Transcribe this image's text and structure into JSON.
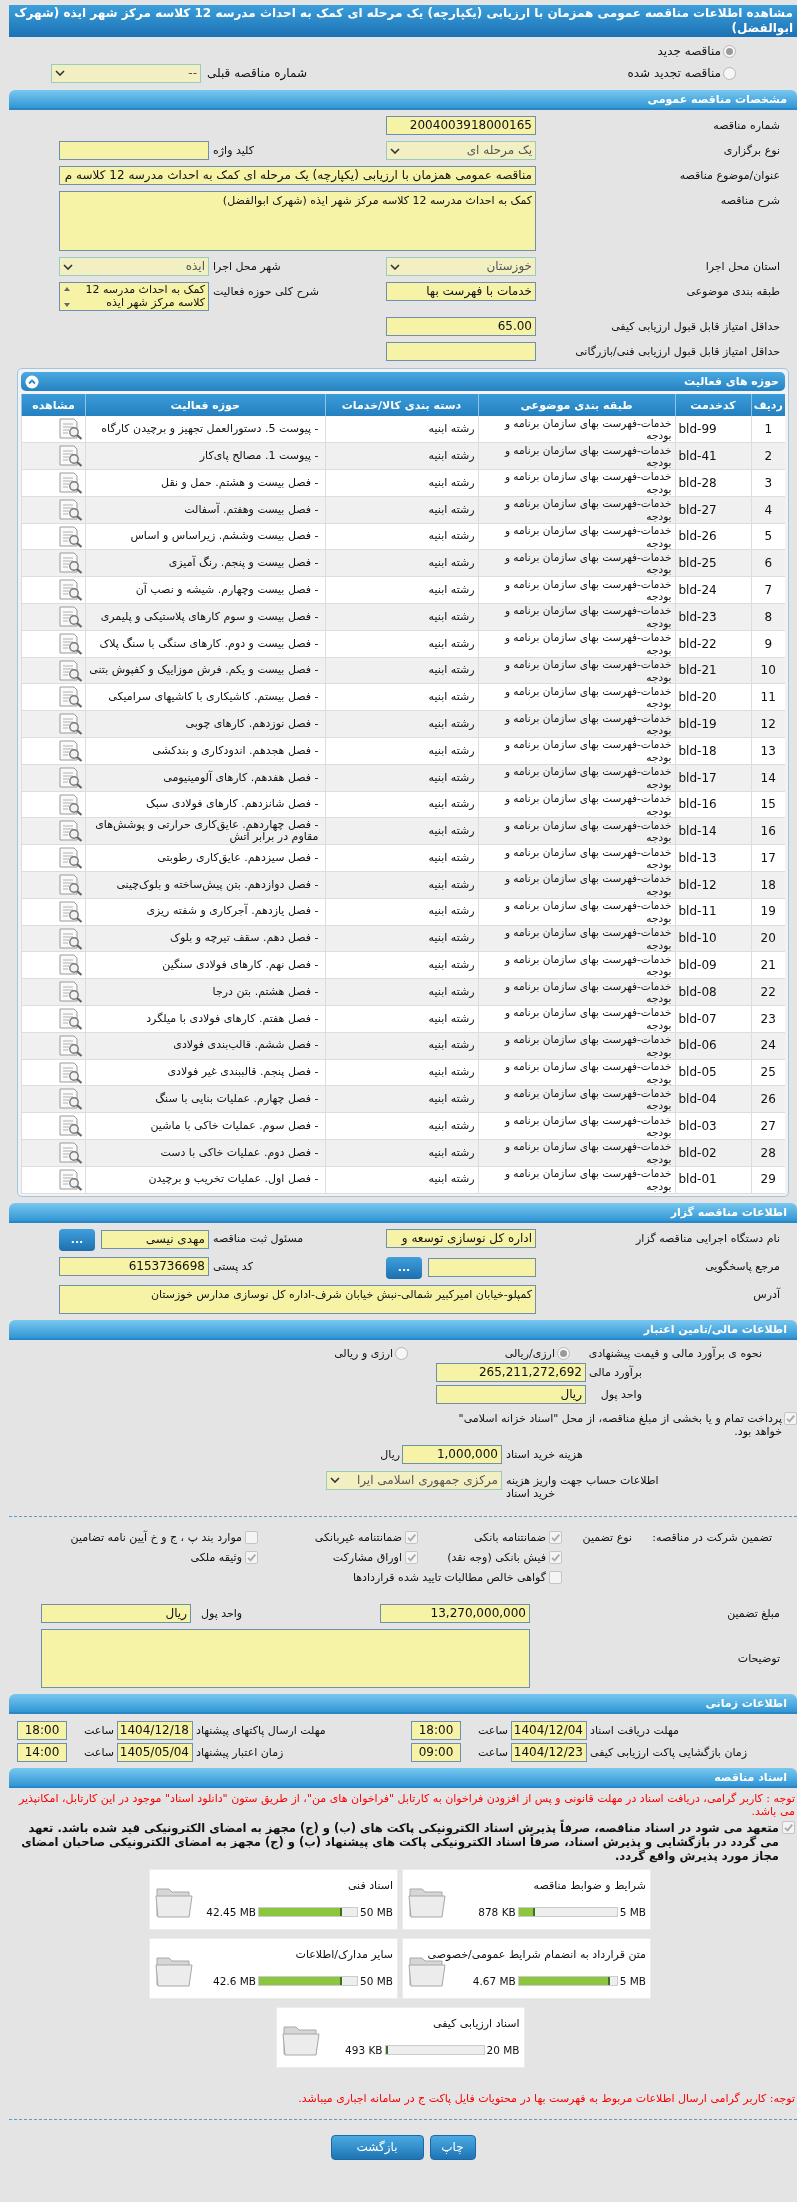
{
  "title": "مشاهده اطلاعات مناقصه عمومی همزمان با ارزیابی (یکپارچه) یک مرحله ای کمک به احداث مدرسه 12 کلاسه مرکز شهر ایذه (شهرک ابوالفضل)",
  "tender_status": [
    {
      "label": "مناقصه جدید",
      "selected": true
    },
    {
      "label": "مناقصه تجدید شده",
      "selected": false
    }
  ],
  "previous_tender": {
    "label": "شماره مناقصه قبلی",
    "kind": "select",
    "value": "--"
  },
  "general": {
    "header": "مشخصات مناقصه عمومی",
    "rows": [
      [
        {
          "label": "شماره مناقصه",
          "kind": "text",
          "value": "2004003918000165"
        }
      ],
      [
        {
          "label": "نوع برگزاری",
          "kind": "select",
          "value": "یک مرحله ای"
        },
        {
          "label": "کلید واژه",
          "kind": "text"
        }
      ],
      [
        {
          "label": "عنوان/موضوع مناقصه",
          "kind": "wide",
          "value": "مناقصه عمومی همزمان با ارزیابی (یکپارچه) یک مرحله ای کمک به احداث مدرسه 12 کلاسه م"
        }
      ],
      [
        {
          "label": "شرح مناقصه",
          "kind": "textarea",
          "value": "کمک به احداث مدرسه 12 کلاسه مرکز شهر ایذه (شهرک ابوالفضل)"
        }
      ],
      [
        {
          "label": "استان محل اجرا",
          "kind": "select",
          "value": "خوزستان"
        },
        {
          "label": "شهر محل اجرا",
          "kind": "select",
          "value": "ایذه"
        }
      ],
      [
        {
          "label": "طبقه بندی موضوعی",
          "kind": "text",
          "value": "خدمات با فهرست بها"
        },
        {
          "label": "شرح کلی حوزه فعالیت",
          "kind": "listbox",
          "value": "کمک به احداث مدرسه 12 کلاسه مرکز شهر ایذه"
        }
      ],
      [
        {
          "label": "حداقل امتیاز قابل قبول ارزیابی کیفی",
          "kind": "text",
          "value": "65.00"
        }
      ],
      [
        {
          "label": "حداقل امتیاز قابل قبول ارزیابی فنی/بازرگانی",
          "kind": "text"
        }
      ]
    ]
  },
  "activities": {
    "header": "حوزه های فعالیت",
    "columns": [
      "ردیف",
      "کدخدمت",
      "طبقه بندی موضوعی",
      "دسته بندی کالا/خدمات",
      "حوزه فعالیت",
      "مشاهده"
    ],
    "rows": [
      {
        "row": "1",
        "code": "bld-99",
        "category": "خدمات-فهرست بهای سازمان برنامه و بودجه",
        "group": "رشته ابنیه",
        "activity": "- پیوست 5. دستورالعمل تجهیز و برچیدن کارگاه"
      },
      {
        "row": "2",
        "code": "bld-41",
        "category": "خدمات-فهرست بهای سازمان برنامه و بودجه",
        "group": "رشته ابنیه",
        "activity": "- پیوست 1. مصالح پای‌کار"
      },
      {
        "row": "3",
        "code": "bld-28",
        "category": "خدمات-فهرست بهای سازمان برنامه و بودجه",
        "group": "رشته ابنیه",
        "activity": "- فصل بیست و هشتم. حمل و نقل"
      },
      {
        "row": "4",
        "code": "bld-27",
        "category": "خدمات-فهرست بهای سازمان برنامه و بودجه",
        "group": "رشته ابنیه",
        "activity": "- فصل بیست وهفتم. آسفالت"
      },
      {
        "row": "5",
        "code": "bld-26",
        "category": "خدمات-فهرست بهای سازمان برنامه و بودجه",
        "group": "رشته ابنیه",
        "activity": "- فصل بیست وششم. زیراساس و اساس"
      },
      {
        "row": "6",
        "code": "bld-25",
        "category": "خدمات-فهرست بهای سازمان برنامه و بودجه",
        "group": "رشته ابنیه",
        "activity": "- فصل بیست و پنجم. رنگ آمیزی"
      },
      {
        "row": "7",
        "code": "bld-24",
        "category": "خدمات-فهرست بهای سازمان برنامه و بودجه",
        "group": "رشته ابنیه",
        "activity": "- فصل بیست وچهارم. شیشه و نصب آن"
      },
      {
        "row": "8",
        "code": "bld-23",
        "category": "خدمات-فهرست بهای سازمان برنامه و بودجه",
        "group": "رشته ابنیه",
        "activity": "- فصل بیست و سوم کارهای پلاستیکی و پلیمری"
      },
      {
        "row": "9",
        "code": "bld-22",
        "category": "خدمات-فهرست بهای سازمان برنامه و بودجه",
        "group": "رشته ابنیه",
        "activity": "- فصل بیست و دوم. کارهای سنگی با سنگ پلاک"
      },
      {
        "row": "10",
        "code": "bld-21",
        "category": "خدمات-فهرست بهای سازمان برنامه و بودجه",
        "group": "رشته ابنیه",
        "activity": "- فصل بیست و یکم. فرش موزاییک و کفپوش بتنی"
      },
      {
        "row": "11",
        "code": "bld-20",
        "category": "خدمات-فهرست بهای سازمان برنامه و بودجه",
        "group": "رشته ابنیه",
        "activity": "- فصل بیستم. کاشیکاری با کاشیهای سرامیکی"
      },
      {
        "row": "12",
        "code": "bld-19",
        "category": "خدمات-فهرست بهای سازمان برنامه و بودجه",
        "group": "رشته ابنیه",
        "activity": "- فصل نوزدهم. کارهای چوبی"
      },
      {
        "row": "13",
        "code": "bld-18",
        "category": "خدمات-فهرست بهای سازمان برنامه و بودجه",
        "group": "رشته ابنیه",
        "activity": "- فصل هجدهم. اندودکاری و بندکشی"
      },
      {
        "row": "14",
        "code": "bld-17",
        "category": "خدمات-فهرست بهای سازمان برنامه و بودجه",
        "group": "رشته ابنیه",
        "activity": "- فصل هفدهم. کارهای آلومینیومی"
      },
      {
        "row": "15",
        "code": "bld-16",
        "category": "خدمات-فهرست بهای سازمان برنامه و بودجه",
        "group": "رشته ابنیه",
        "activity": "- فصل شانزدهم. کارهای فولادی سبک"
      },
      {
        "row": "16",
        "code": "bld-14",
        "category": "خدمات-فهرست بهای سازمان برنامه و بودجه",
        "group": "رشته ابنیه",
        "activity": "- فصل چهاردهم. عایق‌کاری حرارتی و پوشش‌های مقاوم در برابر آتش"
      },
      {
        "row": "17",
        "code": "bld-13",
        "category": "خدمات-فهرست بهای سازمان برنامه و بودجه",
        "group": "رشته ابنیه",
        "activity": "- فصل سیزدهم. عایق‌کاری رطوبتی"
      },
      {
        "row": "18",
        "code": "bld-12",
        "category": "خدمات-فهرست بهای سازمان برنامه و بودجه",
        "group": "رشته ابنیه",
        "activity": "- فصل دوازدهم. بتن پیش‌ساخته و بلوک‌چینی"
      },
      {
        "row": "19",
        "code": "bld-11",
        "category": "خدمات-فهرست بهای سازمان برنامه و بودجه",
        "group": "رشته ابنیه",
        "activity": "- فصل یازدهم. آجرکاری و شفته ریزی"
      },
      {
        "row": "20",
        "code": "bld-10",
        "category": "خدمات-فهرست بهای سازمان برنامه و بودجه",
        "group": "رشته ابنیه",
        "activity": "- فصل دهم. سقف تیرچه و بلوک"
      },
      {
        "row": "21",
        "code": "bld-09",
        "category": "خدمات-فهرست بهای سازمان برنامه و بودجه",
        "group": "رشته ابنیه",
        "activity": "- فصل نهم. کارهای فولادی سنگین"
      },
      {
        "row": "22",
        "code": "bld-08",
        "category": "خدمات-فهرست بهای سازمان برنامه و بودجه",
        "group": "رشته ابنیه",
        "activity": "- فصل هشتم. بتن درجا"
      },
      {
        "row": "23",
        "code": "bld-07",
        "category": "خدمات-فهرست بهای سازمان برنامه و بودجه",
        "group": "رشته ابنیه",
        "activity": "- فصل هفتم. کارهای فولادی با میلگرد"
      },
      {
        "row": "24",
        "code": "bld-06",
        "category": "خدمات-فهرست بهای سازمان برنامه و بودجه",
        "group": "رشته ابنیه",
        "activity": "- فصل ششم. قالب‌بندی فولادی"
      },
      {
        "row": "25",
        "code": "bld-05",
        "category": "خدمات-فهرست بهای سازمان برنامه و بودجه",
        "group": "رشته ابنیه",
        "activity": "- فصل پنجم. قالببندی غیر فولادی"
      },
      {
        "row": "26",
        "code": "bld-04",
        "category": "خدمات-فهرست بهای سازمان برنامه و بودجه",
        "group": "رشته ابنیه",
        "activity": "- فصل چهارم. عملیات بنایی با سنگ"
      },
      {
        "row": "27",
        "code": "bld-03",
        "category": "خدمات-فهرست بهای سازمان برنامه و بودجه",
        "group": "رشته ابنیه",
        "activity": "- فصل سوم. عملیات خاکی با ماشین"
      },
      {
        "row": "28",
        "code": "bld-02",
        "category": "خدمات-فهرست بهای سازمان برنامه و بودجه",
        "group": "رشته ابنیه",
        "activity": "- فصل دوم. عملیات خاکی با دست"
      },
      {
        "row": "29",
        "code": "bld-01",
        "category": "خدمات-فهرست بهای سازمان برنامه و بودجه",
        "group": "رشته ابنیه",
        "activity": "- فصل اول. عملیات تخریب و برچیدن"
      }
    ]
  },
  "organizer": {
    "header": "اطلاعات مناقصه گزار",
    "rows": [
      [
        {
          "label": "نام دستگاه اجرایی مناقصه گزار",
          "kind": "text",
          "value": "اداره کل نوسازی  توسعه و"
        },
        {
          "label": "مسئول ثبت مناقصه",
          "kind": "text",
          "value": "مهدی نیسی",
          "button": "..."
        }
      ],
      [
        {
          "label": "مرجع پاسخگویی",
          "kind": "text",
          "button": "..."
        },
        {
          "label": "کد پستی",
          "kind": "text",
          "value": "6153736698"
        }
      ],
      [
        {
          "label": "آدرس",
          "kind": "address",
          "value": "کمپلو-خیابان امیرکبیر شمالی-نبش خیابان شرف-اداره کل نوسازی مدارس خوزستان"
        }
      ]
    ]
  },
  "finance": {
    "header": "اطلاعات مالی/تامین اعتبار",
    "method": {
      "label": "نحوه ی برآورد مالی و قیمت پیشنهادی",
      "options": [
        {
          "label": "ارزی/ریالی",
          "selected": true
        },
        {
          "label": "ارزی و ریالی",
          "selected": false
        }
      ]
    },
    "estimate": {
      "label": "برآورد مالی",
      "value": "265,211,272,692"
    },
    "currency": {
      "label": "واحد پول",
      "value": "ریال"
    },
    "treasury": {
      "text": "پرداخت تمام و یا بخشی از مبلغ مناقصه، از محل \"اسناد خزانه اسلامی\" خواهد بود.",
      "checked": true
    },
    "document_fee": {
      "label": "هزینه خرید اسناد",
      "value": "1,000,000",
      "unit": "ریال"
    },
    "account": {
      "label": "اطلاعات حساب جهت واریز هزینه خرید اسناد",
      "value": "مرکزی جمهوری اسلامی ایرا"
    }
  },
  "guarantee": {
    "label": "تضمین شرکت در مناقصه:",
    "type_label": "نوع تضمین",
    "options": [
      {
        "label": "ضمانتنامه بانکی",
        "checked": true
      },
      {
        "label": "ضمانتنامه غیربانکی",
        "checked": true
      },
      {
        "label": "موارد بند پ ، ج و خ آیین نامه تضامین",
        "checked": false
      },
      {
        "label": "فیش بانکی (وجه نقد)",
        "checked": true
      },
      {
        "label": "اوراق مشارکت",
        "checked": true
      },
      {
        "label": "وثیقه ملکی",
        "checked": true
      },
      {
        "label": "گواهی خالص مطالبات تایید شده قراردادها",
        "checked": false
      }
    ],
    "amount": {
      "label": "مبلغ تضمین",
      "value": "13,270,000,000"
    },
    "currency": {
      "label": "واحد پول",
      "value": "ریال"
    },
    "notes": {
      "label": "توضیحات"
    }
  },
  "schedule": {
    "header": "اطلاعات زمانی",
    "items": [
      {
        "label": "مهلت دریافت اسناد",
        "date": "1404/12/04",
        "time_label": "ساعت",
        "time": "18:00"
      },
      {
        "label": "مهلت ارسال پاکتهای پیشنهاد",
        "date": "1404/12/18",
        "time_label": "ساعت",
        "time": "18:00"
      },
      {
        "label": "زمان بازگشایی پاکت ارزیابی کیفی",
        "date": "1404/12/23",
        "time_label": "ساعت",
        "time": "09:00"
      },
      {
        "label": "زمان اعتبار پیشنهاد",
        "date": "1405/05/04",
        "time_label": "ساعت",
        "time": "14:00"
      }
    ]
  },
  "documents": {
    "header": "اسناد مناقصه",
    "notice": "توجه : کاربر گرامی، دریافت اسناد در مهلت قانونی و پس از افزودن فراخوان به کارتابل \"فراخوان های من\"، از طریق ستون \"دانلود اسناد\" موجود در این کارتابل، امکانپذیر می باشد.",
    "commitment": {
      "checked": true,
      "text": "متعهد می شود در اسناد مناقصه، صرفاً پذیرش اسناد الکترونیکی پاکت های (ب) و (ج) مجهز به امضای الکترونیکی قید شده باشد. تعهد می گردد در بازگشایی و پذیرش اسناد، صرفاً اسناد الکترونیکی پاکت های پیشنهاد (ب) و (ج) مجهز به امضای الکترونیکی صاحبان امضای مجاز مورد پذیرش واقع گردد."
    },
    "files": [
      {
        "name": "شرایط و ضوابط مناقصه",
        "used": "878 KB",
        "max": "5 MB",
        "level": 0.17
      },
      {
        "name": "اسناد فنی",
        "used": "42.45 MB",
        "max": "50 MB",
        "level": 0.85
      },
      {
        "name": "متن قرارداد به انضمام شرایط عمومی/خصوصی",
        "used": "4.67 MB",
        "max": "5 MB",
        "level": 0.93
      },
      {
        "name": "سایر مدارک/اطلاعات",
        "used": "42.6 MB",
        "max": "50 MB",
        "level": 0.85
      },
      {
        "name": "اسناد ارزیابی کیفی",
        "used": "493 KB",
        "max": "20 MB",
        "level": 0.024
      }
    ],
    "footer_note": "توجه: کاربر گرامی ارسال اطلاعات مربوط به فهرست بها در محتویات فایل پاکت ج در سامانه اجباری میباشد."
  },
  "buttons": [
    "چاپ",
    "بازگشت"
  ]
}
